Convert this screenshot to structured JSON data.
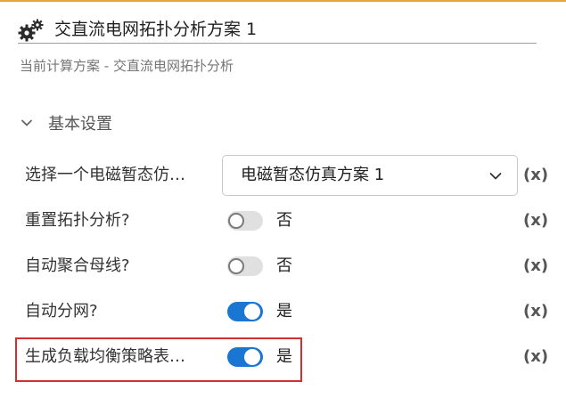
{
  "header": {
    "title": "交直流电网拓扑分析方案 1",
    "icon": "gear-icon"
  },
  "subtitle": "当前计算方案 - 交直流电网拓扑分析",
  "section": {
    "title": "基本设置",
    "icon": "chevron-down-icon"
  },
  "rows": [
    {
      "label": "选择一个电磁暂态仿…",
      "type": "select",
      "value": "电磁暂态仿真方案 1",
      "variable_label": "(x)"
    },
    {
      "label": "重置拓扑分析?",
      "type": "toggle",
      "checked": false,
      "value_text": "否",
      "variable_label": "(x)"
    },
    {
      "label": "自动聚合母线?",
      "type": "toggle",
      "checked": false,
      "value_text": "否",
      "variable_label": "(x)"
    },
    {
      "label": "自动分网?",
      "type": "toggle",
      "checked": true,
      "value_text": "是",
      "variable_label": "(x)"
    },
    {
      "label": "生成负载均衡策略表…",
      "type": "toggle",
      "checked": true,
      "value_text": "是",
      "variable_label": "(x)"
    }
  ],
  "colors": {
    "accent": "#1976d2",
    "highlight": "#d32f2f",
    "top_border": "#e8a33d"
  }
}
